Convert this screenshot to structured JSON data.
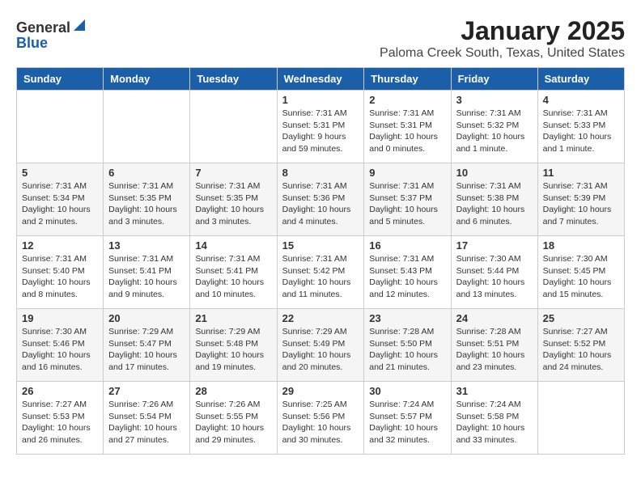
{
  "logo": {
    "general": "General",
    "blue": "Blue"
  },
  "header": {
    "title": "January 2025",
    "subtitle": "Paloma Creek South, Texas, United States"
  },
  "weekdays": [
    "Sunday",
    "Monday",
    "Tuesday",
    "Wednesday",
    "Thursday",
    "Friday",
    "Saturday"
  ],
  "weeks": [
    [
      {
        "day": "",
        "content": ""
      },
      {
        "day": "",
        "content": ""
      },
      {
        "day": "",
        "content": ""
      },
      {
        "day": "1",
        "content": "Sunrise: 7:31 AM\nSunset: 5:31 PM\nDaylight: 9 hours and 59 minutes."
      },
      {
        "day": "2",
        "content": "Sunrise: 7:31 AM\nSunset: 5:31 PM\nDaylight: 10 hours and 0 minutes."
      },
      {
        "day": "3",
        "content": "Sunrise: 7:31 AM\nSunset: 5:32 PM\nDaylight: 10 hours and 1 minute."
      },
      {
        "day": "4",
        "content": "Sunrise: 7:31 AM\nSunset: 5:33 PM\nDaylight: 10 hours and 1 minute."
      }
    ],
    [
      {
        "day": "5",
        "content": "Sunrise: 7:31 AM\nSunset: 5:34 PM\nDaylight: 10 hours and 2 minutes."
      },
      {
        "day": "6",
        "content": "Sunrise: 7:31 AM\nSunset: 5:35 PM\nDaylight: 10 hours and 3 minutes."
      },
      {
        "day": "7",
        "content": "Sunrise: 7:31 AM\nSunset: 5:35 PM\nDaylight: 10 hours and 3 minutes."
      },
      {
        "day": "8",
        "content": "Sunrise: 7:31 AM\nSunset: 5:36 PM\nDaylight: 10 hours and 4 minutes."
      },
      {
        "day": "9",
        "content": "Sunrise: 7:31 AM\nSunset: 5:37 PM\nDaylight: 10 hours and 5 minutes."
      },
      {
        "day": "10",
        "content": "Sunrise: 7:31 AM\nSunset: 5:38 PM\nDaylight: 10 hours and 6 minutes."
      },
      {
        "day": "11",
        "content": "Sunrise: 7:31 AM\nSunset: 5:39 PM\nDaylight: 10 hours and 7 minutes."
      }
    ],
    [
      {
        "day": "12",
        "content": "Sunrise: 7:31 AM\nSunset: 5:40 PM\nDaylight: 10 hours and 8 minutes."
      },
      {
        "day": "13",
        "content": "Sunrise: 7:31 AM\nSunset: 5:41 PM\nDaylight: 10 hours and 9 minutes."
      },
      {
        "day": "14",
        "content": "Sunrise: 7:31 AM\nSunset: 5:41 PM\nDaylight: 10 hours and 10 minutes."
      },
      {
        "day": "15",
        "content": "Sunrise: 7:31 AM\nSunset: 5:42 PM\nDaylight: 10 hours and 11 minutes."
      },
      {
        "day": "16",
        "content": "Sunrise: 7:31 AM\nSunset: 5:43 PM\nDaylight: 10 hours and 12 minutes."
      },
      {
        "day": "17",
        "content": "Sunrise: 7:30 AM\nSunset: 5:44 PM\nDaylight: 10 hours and 13 minutes."
      },
      {
        "day": "18",
        "content": "Sunrise: 7:30 AM\nSunset: 5:45 PM\nDaylight: 10 hours and 15 minutes."
      }
    ],
    [
      {
        "day": "19",
        "content": "Sunrise: 7:30 AM\nSunset: 5:46 PM\nDaylight: 10 hours and 16 minutes."
      },
      {
        "day": "20",
        "content": "Sunrise: 7:29 AM\nSunset: 5:47 PM\nDaylight: 10 hours and 17 minutes."
      },
      {
        "day": "21",
        "content": "Sunrise: 7:29 AM\nSunset: 5:48 PM\nDaylight: 10 hours and 19 minutes."
      },
      {
        "day": "22",
        "content": "Sunrise: 7:29 AM\nSunset: 5:49 PM\nDaylight: 10 hours and 20 minutes."
      },
      {
        "day": "23",
        "content": "Sunrise: 7:28 AM\nSunset: 5:50 PM\nDaylight: 10 hours and 21 minutes."
      },
      {
        "day": "24",
        "content": "Sunrise: 7:28 AM\nSunset: 5:51 PM\nDaylight: 10 hours and 23 minutes."
      },
      {
        "day": "25",
        "content": "Sunrise: 7:27 AM\nSunset: 5:52 PM\nDaylight: 10 hours and 24 minutes."
      }
    ],
    [
      {
        "day": "26",
        "content": "Sunrise: 7:27 AM\nSunset: 5:53 PM\nDaylight: 10 hours and 26 minutes."
      },
      {
        "day": "27",
        "content": "Sunrise: 7:26 AM\nSunset: 5:54 PM\nDaylight: 10 hours and 27 minutes."
      },
      {
        "day": "28",
        "content": "Sunrise: 7:26 AM\nSunset: 5:55 PM\nDaylight: 10 hours and 29 minutes."
      },
      {
        "day": "29",
        "content": "Sunrise: 7:25 AM\nSunset: 5:56 PM\nDaylight: 10 hours and 30 minutes."
      },
      {
        "day": "30",
        "content": "Sunrise: 7:24 AM\nSunset: 5:57 PM\nDaylight: 10 hours and 32 minutes."
      },
      {
        "day": "31",
        "content": "Sunrise: 7:24 AM\nSunset: 5:58 PM\nDaylight: 10 hours and 33 minutes."
      },
      {
        "day": "",
        "content": ""
      }
    ]
  ]
}
